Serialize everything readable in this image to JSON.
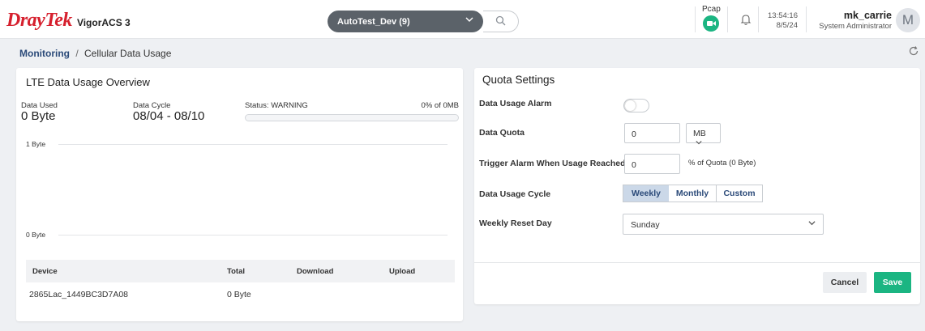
{
  "header": {
    "brand": "DrayTek",
    "product": "VigorACS 3",
    "org_selector": "AutoTest_Dev (9)",
    "pcap_label": "Pcap",
    "time": "13:54:16",
    "date": "8/5/24",
    "user_name": "mk_carrie",
    "user_role": "System Administrator",
    "avatar_initial": "M"
  },
  "breadcrumb": {
    "root": "Monitoring",
    "separator": "/",
    "current": "Cellular Data Usage"
  },
  "overview": {
    "title": "LTE Data Usage Overview",
    "data_used_label": "Data Used",
    "data_used_value": "0 Byte",
    "data_cycle_label": "Data Cycle",
    "data_cycle_value": "08/04 - 08/10",
    "status_text": "Status: WARNING",
    "usage_percent_text": "0% of 0MB",
    "usage_fraction": 0,
    "chart_top_label": "1 Byte",
    "chart_bottom_label": "0 Byte",
    "table": {
      "columns": [
        "Device",
        "Total",
        "Download",
        "Upload"
      ],
      "rows": [
        {
          "device": "2865Lac_1449BC3D7A08",
          "total": "0 Byte",
          "download": "",
          "upload": ""
        }
      ]
    }
  },
  "quota": {
    "title": "Quota Settings",
    "alarm_label": "Data Usage Alarm",
    "alarm_enabled": false,
    "quota_label": "Data Quota",
    "quota_value": "0",
    "quota_unit": "MB",
    "trigger_label": "Trigger Alarm When Usage Reached",
    "trigger_value": "0",
    "trigger_hint": "% of Quota (0 Byte)",
    "cycle_label": "Data Usage Cycle",
    "cycle_options": [
      "Weekly",
      "Monthly",
      "Custom"
    ],
    "cycle_selected": "Weekly",
    "reset_day_label": "Weekly Reset Day",
    "reset_day_value": "Sunday",
    "cancel_label": "Cancel",
    "save_label": "Save"
  },
  "colors": {
    "brand_red": "#d6202e",
    "accent_green": "#1bb582",
    "link_blue": "#2b4a79",
    "segment_active": "#cbd8e8"
  },
  "icons": [
    "search-icon",
    "camera-icon",
    "bell-icon",
    "refresh-icon",
    "chevron-down-icon"
  ]
}
